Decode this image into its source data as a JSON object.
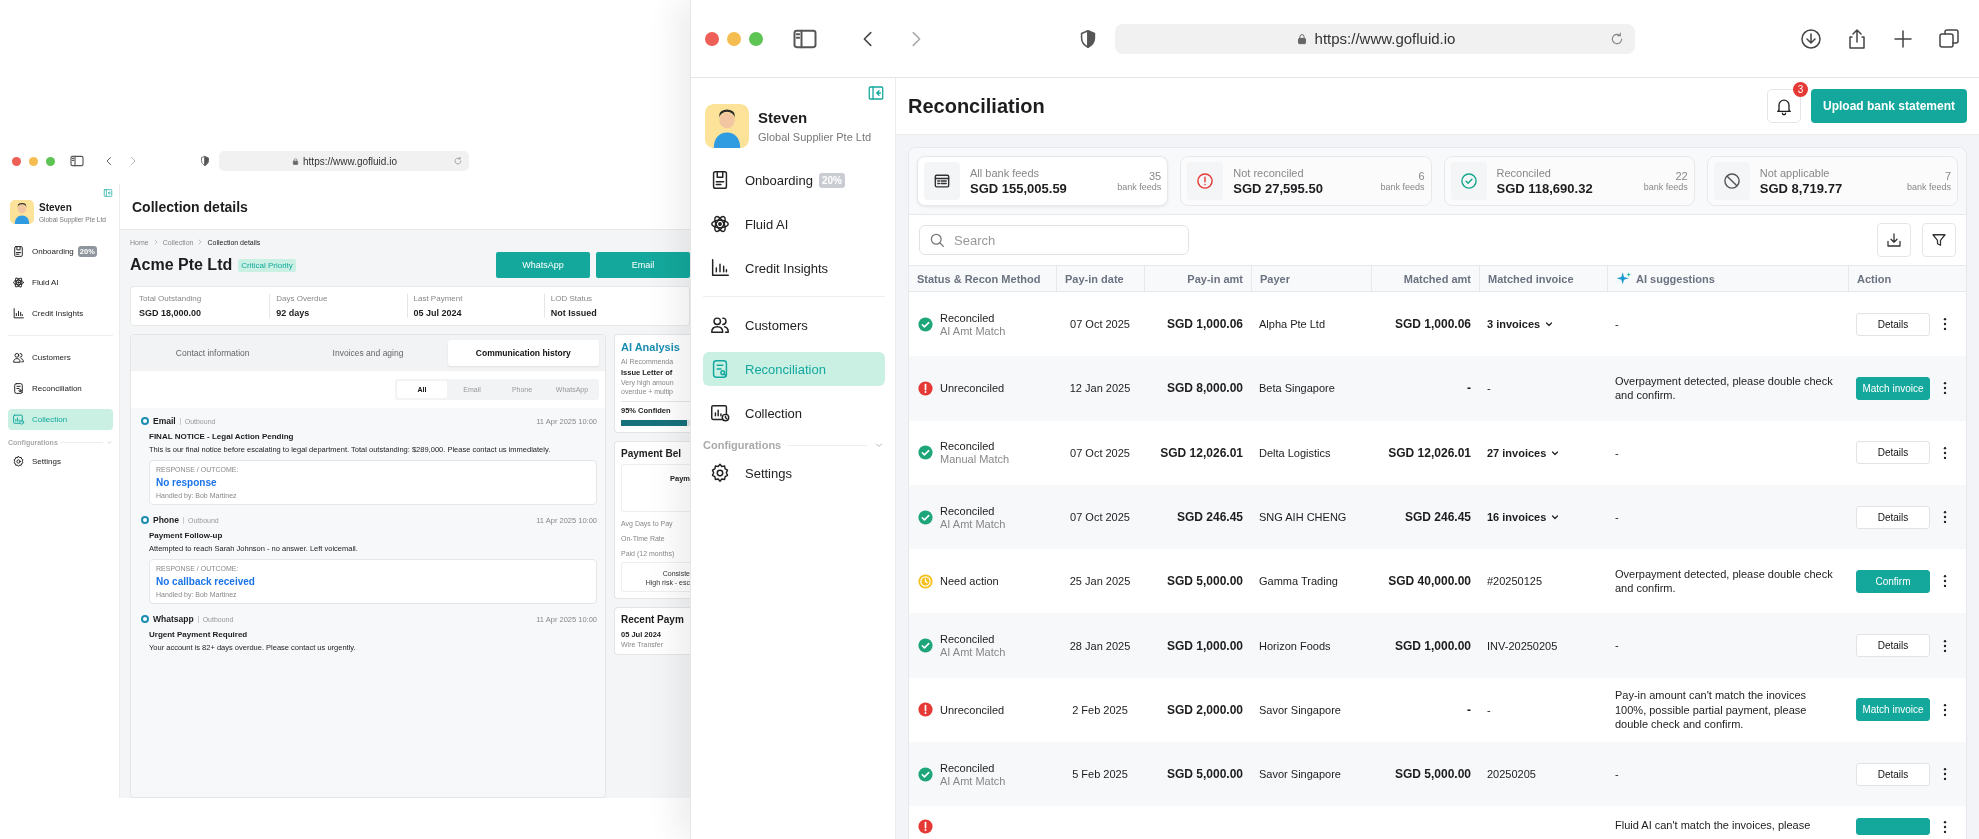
{
  "back_window": {
    "url": "https://www.gofluid.io",
    "sidebar": {
      "user": {
        "name": "Steven",
        "company": "Global Supplier Pte Ltd"
      },
      "groups": [
        {
          "items": [
            {
              "label": "Onboarding",
              "badge": "20%",
              "selected": false
            },
            {
              "label": "Fluid AI",
              "selected": false
            },
            {
              "label": "Credit Insights",
              "selected": false
            }
          ]
        },
        {
          "items": [
            {
              "label": "Customers",
              "selected": false
            },
            {
              "label": "Reconciliation",
              "selected": false
            },
            {
              "label": "Collection",
              "selected": true
            }
          ]
        },
        {
          "title": "Configurations",
          "items": [
            {
              "label": "Settings",
              "selected": false
            }
          ]
        }
      ]
    },
    "page_title": "Collection details",
    "breadcrumb": [
      "Home",
      "Collection",
      "Collection details"
    ],
    "company": "Acme Pte Ltd",
    "priority": "Critical Priority",
    "buttons": [
      "WhatsApp",
      "Email"
    ],
    "stats": [
      {
        "label": "Total Outstanding",
        "value": "SGD 18,000.00"
      },
      {
        "label": "Days Overdue",
        "value": "92 days"
      },
      {
        "label": "Last Payment",
        "value": "05 Jul 2024"
      },
      {
        "label": "LOD Status",
        "value": "Not Issued"
      }
    ],
    "tabs": [
      {
        "label": "Contact information",
        "selected": false
      },
      {
        "label": "Invoices and aging",
        "selected": false
      },
      {
        "label": "Communication history",
        "selected": true
      }
    ],
    "filters": [
      {
        "label": "All",
        "selected": true
      },
      {
        "label": "Email",
        "selected": false
      },
      {
        "label": "Phone",
        "selected": false
      },
      {
        "label": "WhatsApp",
        "selected": false
      }
    ],
    "entries": [
      {
        "channel": "Email",
        "direction": "Outbound",
        "time": "11 Apr 2025 10:00",
        "subject": "FINAL NOTICE - Legal Action Pending",
        "body": "This is our final notice before escalating to legal department. Total outstanding: $289,000. Please contact us immediately.",
        "outcome_label": "RESPONSE / OUTCOME:",
        "outcome": "No response",
        "handler": "Handled by: Bob Martinez"
      },
      {
        "channel": "Phone",
        "direction": "Outbound",
        "time": "11 Apr 2025 10:00",
        "subject": "Payment Follow-up",
        "body": "Attempted to reach Sarah Johnson - no answer. Left voicemail.",
        "outcome_label": "RESPONSE / OUTCOME:",
        "outcome": "No callback received",
        "handler": "Handled by: Bob Martinez"
      },
      {
        "channel": "Whatsapp",
        "direction": "Outbound",
        "time": "11 Apr 2025 10:00",
        "subject": "Urgent Payment Required",
        "body": "Your account is 82+ days overdue. Please contact us urgently."
      }
    ],
    "ai_panel": {
      "title": "AI Analysis",
      "label": "AI Recommenda",
      "recommendation": "Issue Letter of",
      "notes": [
        "Very high amoun",
        "overdue + multip"
      ],
      "confidence": "95% Confiden",
      "level": 0.95
    },
    "behaviour_panel": {
      "title": "Payment Bel",
      "card": "Paym",
      "metrics": [
        "Avg Days to Pay",
        "On-Time Rate",
        "Paid (12 months)"
      ],
      "note": [
        "Consiste",
        "High risk - esc"
      ]
    },
    "recent_panel": {
      "title": "Recent Paym",
      "date": "05 Jul 2024",
      "method": "Wire Transfer"
    }
  },
  "window": {
    "url": "https://www.gofluid.io"
  },
  "sidebar": {
    "user": {
      "name": "Steven",
      "company": "Global Supplier Pte Ltd"
    },
    "groups": [
      {
        "items": [
          {
            "label": "Onboarding",
            "badge": "20%",
            "selected": false
          },
          {
            "label": "Fluid AI",
            "selected": false
          },
          {
            "label": "Credit Insights",
            "selected": false
          }
        ]
      },
      {
        "items": [
          {
            "label": "Customers",
            "selected": false
          },
          {
            "label": "Reconciliation",
            "selected": true
          },
          {
            "label": "Collection",
            "selected": false
          }
        ]
      },
      {
        "title": "Configurations",
        "items": [
          {
            "label": "Settings",
            "selected": false
          }
        ]
      }
    ]
  },
  "header": {
    "title": "Reconciliation",
    "notifications": "3",
    "upload_button": "Upload bank statement"
  },
  "summary": [
    {
      "label": "All bank feeds",
      "amount": "SGD 155,005.59",
      "count": "35",
      "count_label": "bank feeds"
    },
    {
      "label": "Not reconciled",
      "amount": "SGD 27,595.50",
      "count": "6",
      "count_label": "bank feeds"
    },
    {
      "label": "Reconciled",
      "amount": "SGD 118,690.32",
      "count": "22",
      "count_label": "bank feeds"
    },
    {
      "label": "Not applicable",
      "amount": "SGD 8,719.77",
      "count": "7",
      "count_label": "bank feeds"
    }
  ],
  "search": {
    "placeholder": "Search"
  },
  "table": {
    "columns": [
      "Status & Recon Method",
      "Pay-in date",
      "Pay-in amt",
      "Payer",
      "Matched amt",
      "Matched invoice",
      "AI suggestions",
      "Action"
    ],
    "rows": [
      {
        "kind": "reconciled",
        "status_label": "Reconciled",
        "method": "AI Amt Match",
        "date": "07 Oct 2025",
        "amount": "SGD 1,000.06",
        "payer": "Alpha Pte Ltd",
        "matched_amt": "SGD 1,000.06",
        "invoice": {
          "kind": "dropdown",
          "text": "3 invoices"
        },
        "suggestion": "-",
        "action": {
          "kind": "secondary",
          "label": "Details"
        }
      },
      {
        "kind": "unreconciled",
        "status_label": "Unreconciled",
        "date": "12 Jan 2025",
        "amount": "SGD 8,000.00",
        "payer": "Beta Singapore",
        "matched_amt": "-",
        "invoice": {
          "kind": "text",
          "text": "-"
        },
        "suggestion": "Overpayment detected, please double check and confirm.",
        "action": {
          "kind": "primary",
          "label": "Match invoice"
        }
      },
      {
        "kind": "reconciled",
        "status_label": "Reconciled",
        "method": "Manual Match",
        "date": "07 Oct 2025",
        "amount": "SGD 12,026.01",
        "payer": "Delta Logistics",
        "matched_amt": "SGD 12,026.01",
        "invoice": {
          "kind": "dropdown",
          "text": "27 invoices"
        },
        "suggestion": "-",
        "action": {
          "kind": "secondary",
          "label": "Details"
        }
      },
      {
        "kind": "reconciled",
        "status_label": "Reconciled",
        "method": "AI Amt Match",
        "date": "07 Oct 2025",
        "amount": "SGD 246.45",
        "payer": "SNG AIH CHENG",
        "matched_amt": "SGD 246.45",
        "invoice": {
          "kind": "dropdown",
          "text": "16 invoices"
        },
        "suggestion": "-",
        "action": {
          "kind": "secondary",
          "label": "Details"
        }
      },
      {
        "kind": "need_action",
        "status_label": "Need action",
        "date": "25 Jan 2025",
        "amount": "SGD 5,000.00",
        "payer": "Gamma Trading",
        "matched_amt": "SGD 40,000.00",
        "invoice": {
          "kind": "text",
          "text": "#20250125"
        },
        "suggestion": "Overpayment detected, please double check and confirm.",
        "action": {
          "kind": "primary",
          "label": "Confirm"
        }
      },
      {
        "kind": "reconciled",
        "status_label": "Reconciled",
        "method": "AI Amt Match",
        "date": "28 Jan 2025",
        "amount": "SGD 1,000.00",
        "payer": "Horizon Foods",
        "matched_amt": "SGD 1,000.00",
        "invoice": {
          "kind": "text",
          "text": "INV-20250205"
        },
        "suggestion": "-",
        "action": {
          "kind": "secondary",
          "label": "Details"
        }
      },
      {
        "kind": "unreconciled",
        "status_label": "Unreconciled",
        "date": "2 Feb 2025",
        "amount": "SGD 2,000.00",
        "payer": "Savor Singapore",
        "matched_amt": "-",
        "invoice": {
          "kind": "text",
          "text": "-"
        },
        "suggestion": "Pay-in amount can't match the inovices 100%, possible partial payment, please double check and confirm.",
        "action": {
          "kind": "primary",
          "label": "Match invoice"
        }
      },
      {
        "kind": "reconciled",
        "status_label": "Reconciled",
        "method": "AI Amt Match",
        "date": "5 Feb 2025",
        "amount": "SGD 5,000.00",
        "payer": "Savor Singapore",
        "matched_amt": "SGD 5,000.00",
        "invoice": {
          "kind": "text",
          "text": "20250205"
        },
        "suggestion": "-",
        "action": {
          "kind": "secondary",
          "label": "Details"
        }
      },
      {
        "kind": "unreconciled",
        "suggestion": "Fluid AI can't match the invoices, please",
        "action": {
          "kind": "primary"
        }
      }
    ]
  }
}
